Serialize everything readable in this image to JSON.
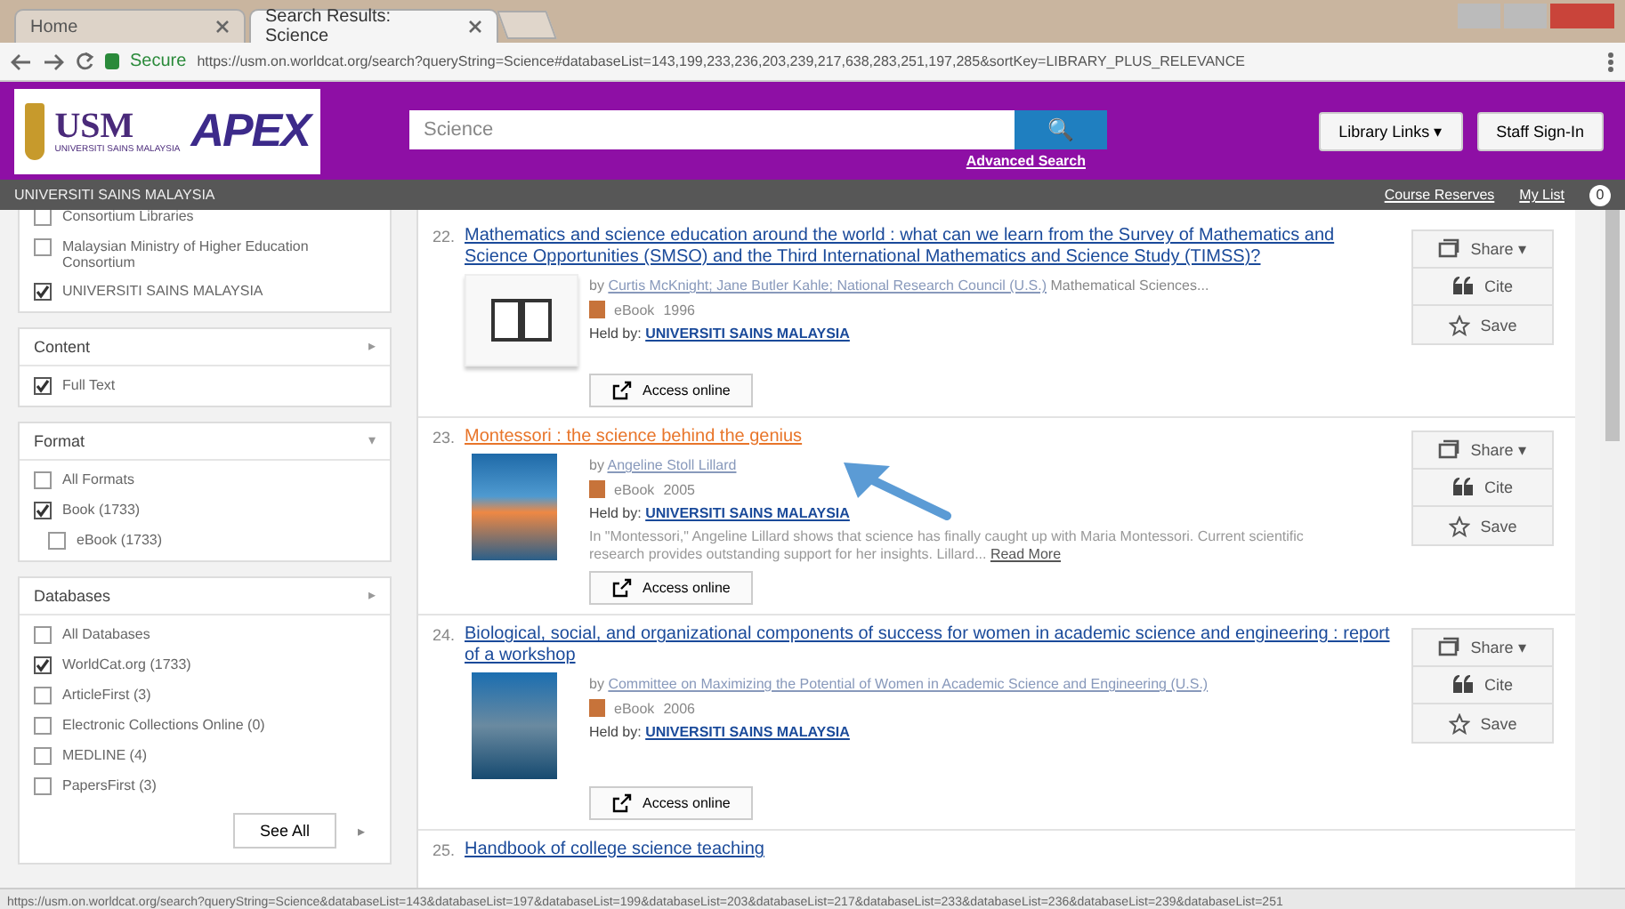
{
  "browser": {
    "tabs": [
      {
        "label": "Home",
        "selected": false
      },
      {
        "label": "Search Results: Science",
        "selected": true
      }
    ],
    "security": "Secure",
    "url": "https://usm.on.worldcat.org/search?queryString=Science#databaseList=143,199,233,236,203,239,217,638,283,251,197,285&sortKey=LIBRARY_PLUS_RELEVANCE",
    "status_url": "https://usm.on.worldcat.org/search?queryString=Science&databaseList=143&databaseList=197&databaseList=199&databaseList=203&databaseList=217&databaseList=233&databaseList=236&databaseList=239&databaseList=251"
  },
  "header": {
    "logo_text": "USM",
    "logo_caption": "UNIVERSITI SAINS MALAYSIA",
    "brand": "APEX",
    "search_value": "Science",
    "search_icon": "🔍",
    "advanced_search": "Advanced Search",
    "library_links": "Library Links ▾",
    "staff_sign_in": "Staff Sign-In"
  },
  "subbar": {
    "institution": "UNIVERSITI SAINS MALAYSIA",
    "course_reserves": "Course Reserves",
    "my_list": "My List",
    "my_list_count": "0"
  },
  "sidebar": {
    "top_items": [
      {
        "label": "Consortium Libraries",
        "checked": false
      },
      {
        "label": "Malaysian Ministry of Higher Education Consortium",
        "checked": false
      },
      {
        "label": "UNIVERSITI SAINS MALAYSIA",
        "checked": true
      }
    ],
    "facets": [
      {
        "title": "Content",
        "toggle": "▸",
        "items": [
          {
            "label": "Full Text",
            "checked": true
          }
        ]
      },
      {
        "title": "Format",
        "toggle": "▾",
        "items": [
          {
            "label": "All Formats",
            "checked": false
          },
          {
            "label": "Book (1733)",
            "checked": true,
            "children": [
              {
                "label": "eBook (1733)",
                "checked": false
              }
            ]
          }
        ]
      },
      {
        "title": "Databases",
        "toggle": "▸",
        "items": [
          {
            "label": "All Databases",
            "checked": false
          },
          {
            "label": "WorldCat.org (1733)",
            "checked": true
          },
          {
            "label": "ArticleFirst (3)",
            "checked": false
          },
          {
            "label": "Electronic Collections Online (0)",
            "checked": false
          },
          {
            "label": "MEDLINE (4)",
            "checked": false
          },
          {
            "label": "PapersFirst (3)",
            "checked": false
          }
        ],
        "see_all": "See All",
        "more": "▸"
      }
    ]
  },
  "results": [
    {
      "number": "22.",
      "title": "Mathematics and science education around the world : what can we learn from the Survey of Mathematics and Science Opportunities (SMSO) and the Third International Mathematics and Science Study (TIMSS)?",
      "visited": false,
      "kind": "book",
      "by": "by",
      "authors": "Curtis McKnight; Jane Butler Kahle; National Research Council (U.S.)",
      "extra": "Mathematical Sciences...",
      "type": "eBook",
      "year": "1996",
      "held_by": "Held by:",
      "library": "UNIVERSITI SAINS MALAYSIA",
      "access": "Access online",
      "share": "Share ▾",
      "cite": "Cite",
      "save": "Save"
    },
    {
      "number": "23.",
      "title": "Montessori : the science behind the genius",
      "visited": true,
      "kind": "cover",
      "by": "by",
      "authors": "Angeline Stoll Lillard",
      "type": "eBook",
      "year": "2005",
      "held_by": "Held by:",
      "library": "UNIVERSITI SAINS MALAYSIA",
      "description": "In \"Montessori,\" Angeline Lillard shows that science has finally caught up with Maria Montessori. Current scientific research provides outstanding support for her insights. Lillard...",
      "read_more": "Read More",
      "access": "Access online",
      "share": "Share ▾",
      "cite": "Cite",
      "save": "Save"
    },
    {
      "number": "24.",
      "title": "Biological, social, and organizational components of success for women in academic science and engineering : report of a workshop",
      "visited": false,
      "kind": "cover",
      "by": "by",
      "authors": "Committee on Maximizing the Potential of Women in Academic Science and Engineering (U.S.)",
      "type": "eBook",
      "year": "2006",
      "held_by": "Held by:",
      "library": "UNIVERSITI SAINS MALAYSIA",
      "access": "Access online",
      "share": "Share ▾",
      "cite": "Cite",
      "save": "Save"
    },
    {
      "number": "25.",
      "title": "Handbook of college science teaching",
      "visited": false
    }
  ]
}
